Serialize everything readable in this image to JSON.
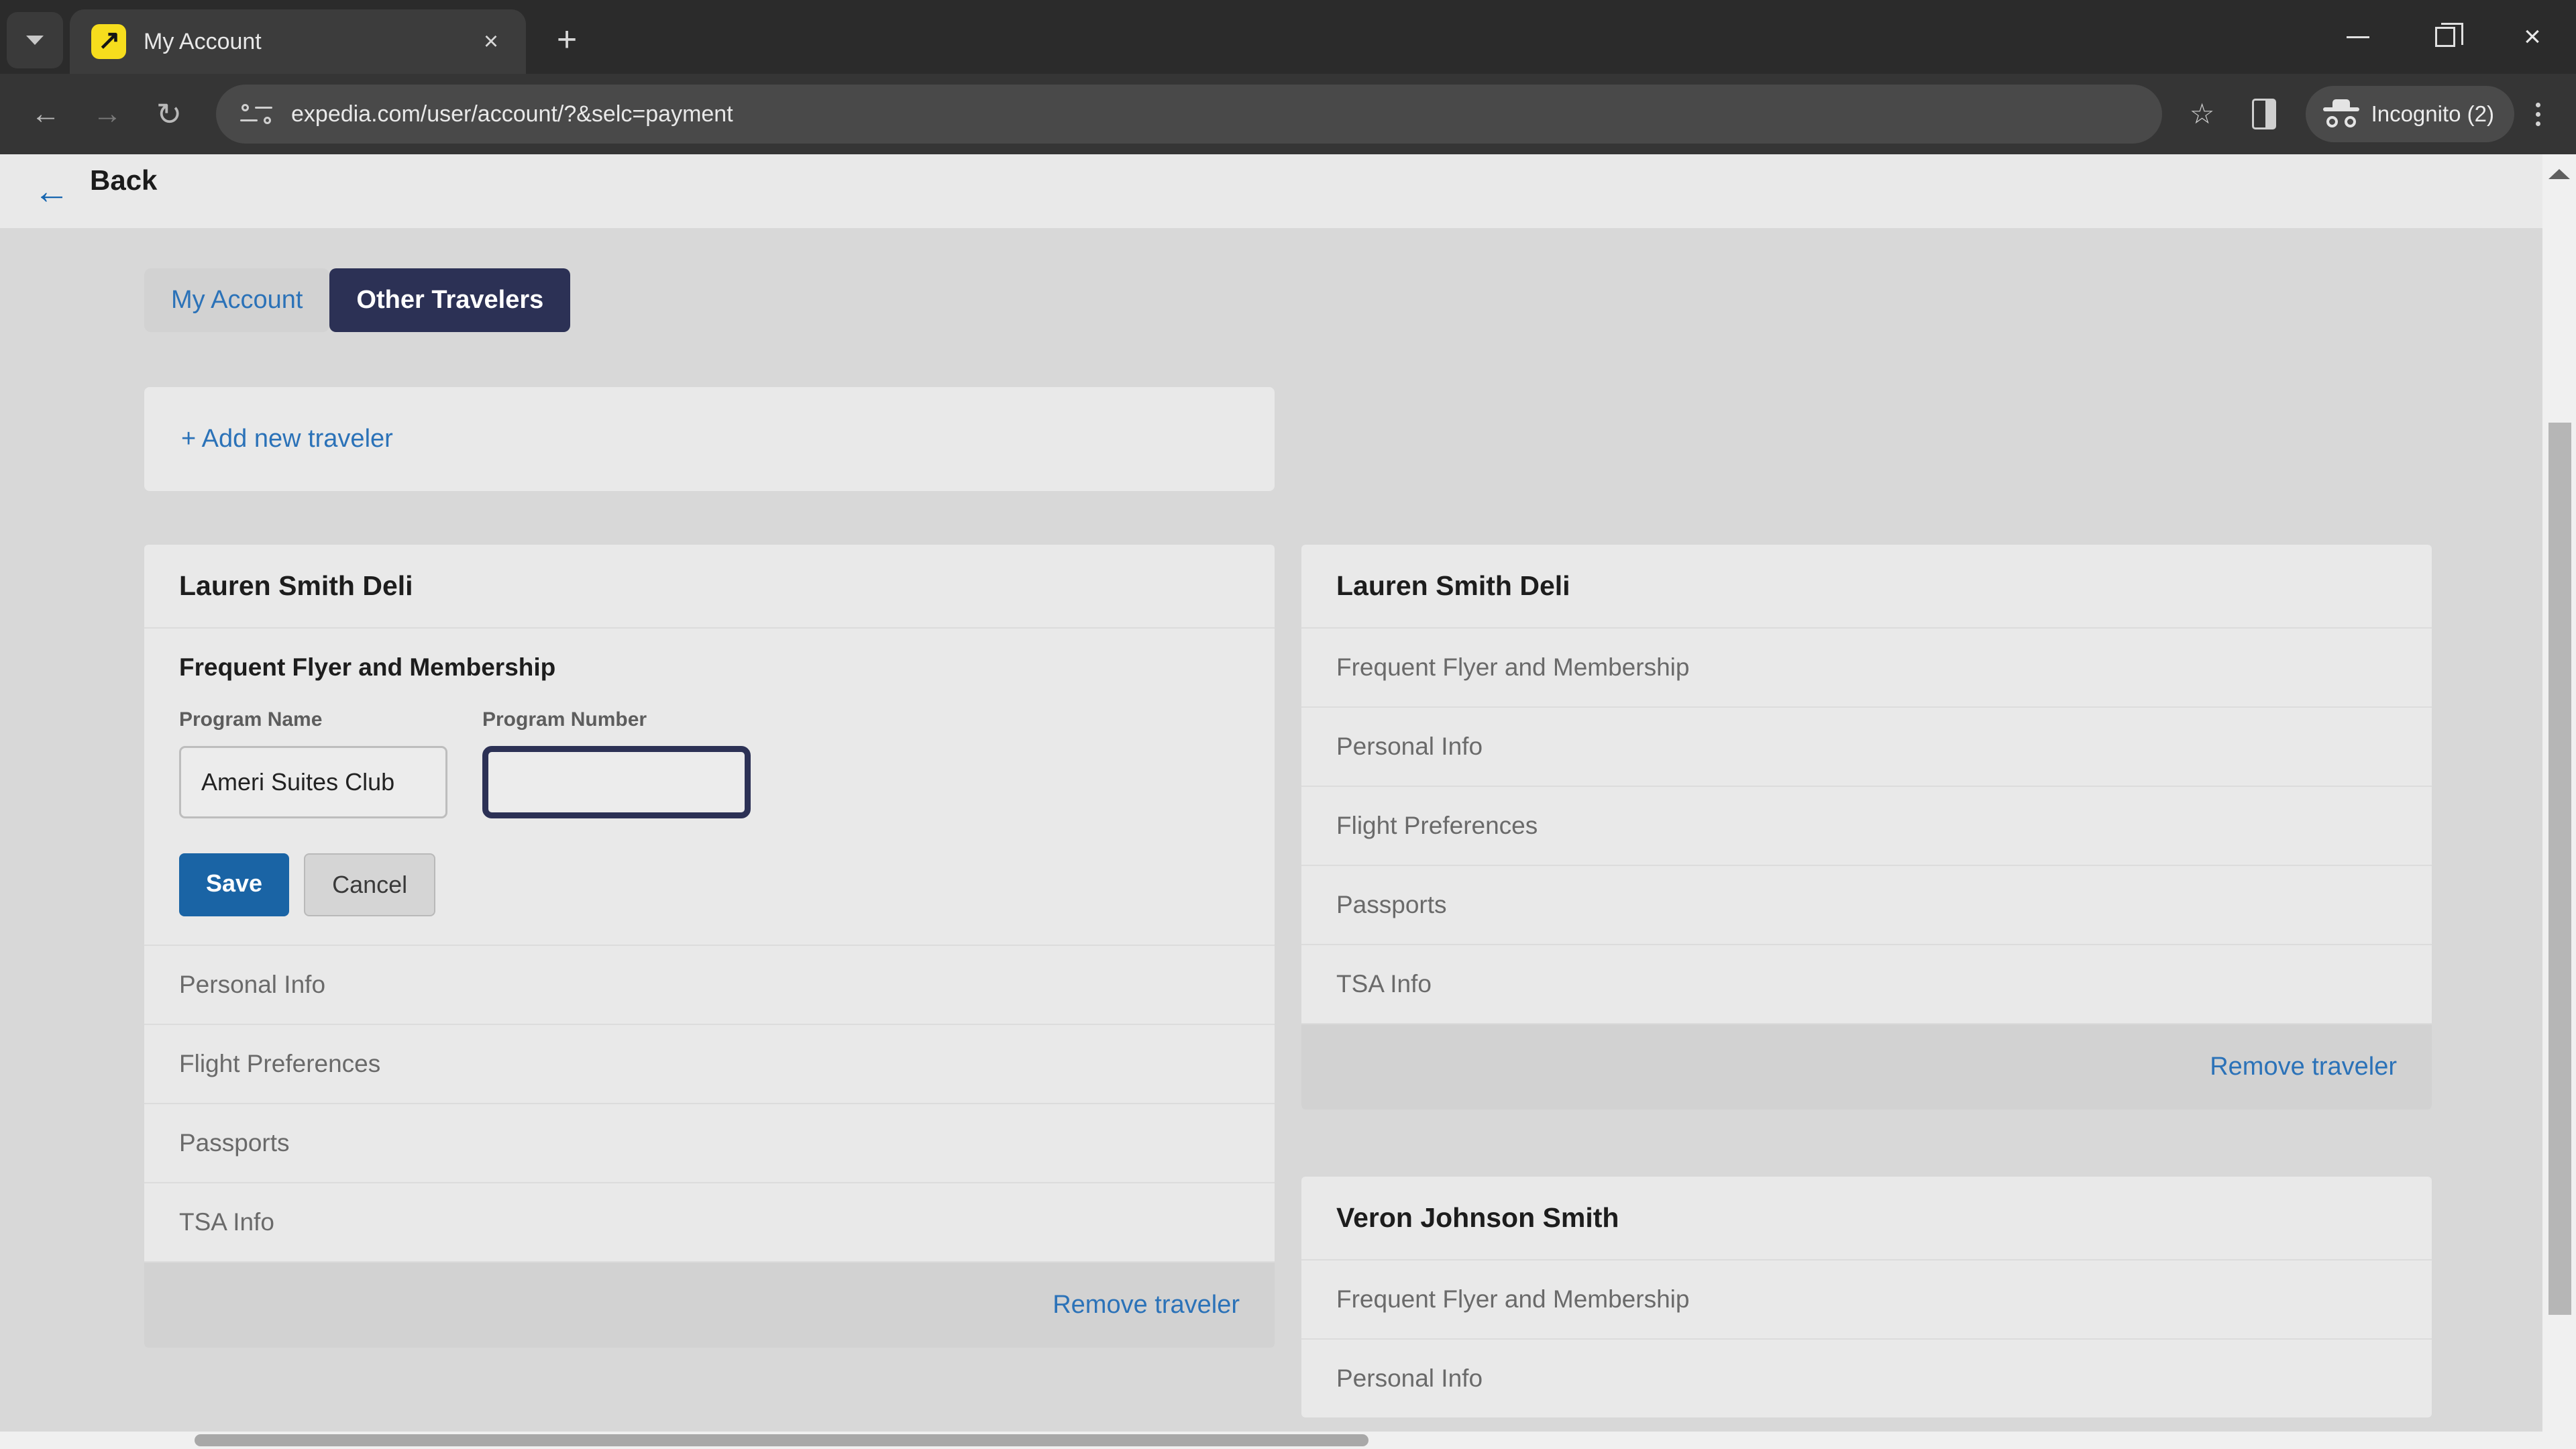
{
  "browser": {
    "tab": {
      "title": "My Account",
      "favicon": "expedia-arrow-icon",
      "close": "×"
    },
    "new_tab": "+",
    "window": {
      "minimize": "minimize-icon",
      "maximize": "restore-icon",
      "close": "×"
    },
    "toolbar": {
      "back": "←",
      "forward": "→",
      "reload": "↻",
      "url": "expedia.com/user/account/?&selc=payment",
      "bookmark": "☆",
      "side_panel": "side-panel-icon",
      "profile_label": "Incognito (2)",
      "menu": "kebab-menu-icon"
    }
  },
  "page": {
    "back_label": "Back",
    "back_arrow": "←",
    "tabs": [
      {
        "label": "My Account",
        "active": false
      },
      {
        "label": "Other Travelers",
        "active": true
      }
    ],
    "add_new_traveler": "+ Add new traveler",
    "left_column": {
      "card": {
        "name": "Lauren Smith Deli",
        "expanded_section": "Frequent Flyer and Membership",
        "form": {
          "program_name_label": "Program Name",
          "program_name_value": "Ameri Suites Club",
          "program_number_label": "Program Number",
          "program_number_value": "",
          "program_number_placeholder": "",
          "save_label": "Save",
          "cancel_label": "Cancel"
        },
        "rows": [
          "Personal Info",
          "Flight Preferences",
          "Passports",
          "TSA Info"
        ],
        "remove_label": "Remove traveler"
      }
    },
    "right_column": {
      "cards": [
        {
          "name": "Lauren Smith Deli",
          "rows": [
            "Frequent Flyer and Membership",
            "Personal Info",
            "Flight Preferences",
            "Passports",
            "TSA Info"
          ],
          "remove_label": "Remove traveler"
        },
        {
          "name": "Veron Johnson Smith",
          "rows": [
            "Frequent Flyer and Membership",
            "Personal Info"
          ]
        }
      ]
    }
  },
  "colors": {
    "accent_link": "#2b72b8",
    "tab_active_bg": "#2c3155",
    "save_button": "#1a64a5",
    "focus_border": "#2c3155",
    "page_bg": "#d8d8d8",
    "card_bg": "#e9e9e9"
  }
}
